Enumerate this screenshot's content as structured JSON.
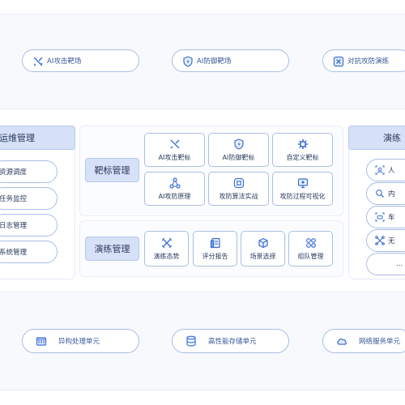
{
  "top_row": [
    {
      "label": "AI攻击靶场",
      "icon": "crossed-swords-icon"
    },
    {
      "label": "AI防御靶场",
      "icon": "shield-icon"
    },
    {
      "label": "对抗攻防演练",
      "icon": "x-square-icon"
    }
  ],
  "left_panel": {
    "title": "运维管理",
    "items": [
      "资源调度",
      "任务监控",
      "日志管理",
      "系统管理"
    ]
  },
  "target_mgmt": {
    "label": "靶标管理",
    "cells": [
      {
        "label": "AI攻击靶标",
        "icon": "crossed-swords-icon"
      },
      {
        "label": "AI防御靶标",
        "icon": "shield-icon"
      },
      {
        "label": "自定义靶标",
        "icon": "gear-icon"
      },
      {
        "label": "AI攻防原理",
        "icon": "network-icon"
      },
      {
        "label": "攻防算法实战",
        "icon": "target-icon"
      },
      {
        "label": "攻防过程可视化",
        "icon": "monitor-icon"
      }
    ]
  },
  "drill_mgmt": {
    "label": "演练管理",
    "cells": [
      {
        "label": "演练态势",
        "icon": "crossed-swords-icon"
      },
      {
        "label": "评分报告",
        "icon": "report-icon"
      },
      {
        "label": "场景选择",
        "icon": "cube-icon"
      },
      {
        "label": "组队管理",
        "icon": "nodes-icon"
      }
    ]
  },
  "right_panel": {
    "title": "演练",
    "items": [
      "人",
      "内",
      "车",
      "无",
      "..."
    ]
  },
  "bottom_row": [
    {
      "label": "异构处理单元",
      "icon": "chip-icon"
    },
    {
      "label": "高性能存储单元",
      "icon": "database-icon"
    },
    {
      "label": "网络服务单元",
      "icon": "cloud-icon"
    }
  ],
  "colors": {
    "accent": "#3b5a9a",
    "border": "#a9bfe6",
    "header_fill": "#d6e1f7",
    "band": "#f7f9fd"
  }
}
